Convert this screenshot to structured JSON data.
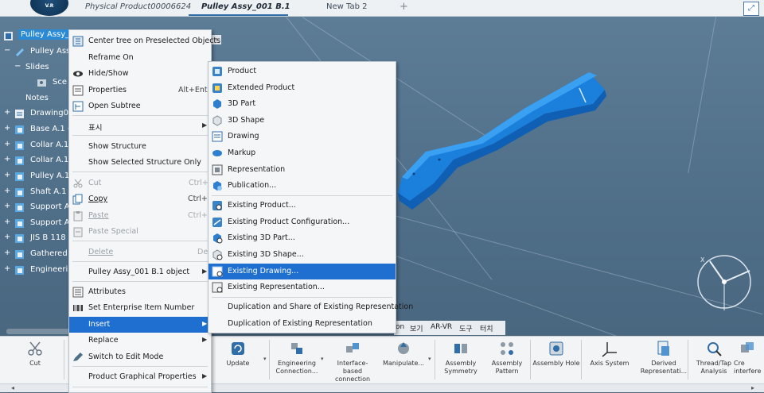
{
  "app": {
    "logo_text": "V.R",
    "tabs": [
      {
        "label": "Physical Product00006624",
        "active": false
      },
      {
        "label": "Pulley Assy_001 B.1",
        "active": true
      },
      {
        "label": "New Tab 2",
        "active": false
      }
    ],
    "new_tab_icon": "+",
    "expand_icon": "expand-icon"
  },
  "tree": {
    "items": [
      {
        "label": "Pulley Assy_0",
        "selected": true,
        "icon": "root-product-icon"
      },
      {
        "label": "Pulley Ass",
        "icon": "product-icon"
      },
      {
        "label": "Slides",
        "icon": "slides-icon"
      },
      {
        "label": "Sce",
        "icon": "scene-icon"
      },
      {
        "label": "Notes",
        "icon": "notes-icon"
      },
      {
        "label": "Drawing00",
        "icon": "drawing-icon"
      },
      {
        "label": "Base A.1 (",
        "icon": "part-icon"
      },
      {
        "label": "Collar A.1",
        "icon": "part-icon"
      },
      {
        "label": "Collar A.1",
        "icon": "part-icon"
      },
      {
        "label": "Pulley A.1",
        "icon": "part-icon"
      },
      {
        "label": "Shaft A.1 (",
        "icon": "part-icon"
      },
      {
        "label": "Support A",
        "icon": "part-icon"
      },
      {
        "label": "Support A",
        "icon": "part-icon"
      },
      {
        "label": "JIS B 118",
        "icon": "part-icon"
      },
      {
        "label": "Gathered",
        "icon": "part-icon"
      },
      {
        "label": "Engineerin",
        "icon": "part-icon"
      }
    ]
  },
  "context_menu": {
    "items": [
      {
        "label": "Center tree on Preselected Objects",
        "icon": "center-tree-icon"
      },
      {
        "label": "Reframe On"
      },
      {
        "label": "Hide/Show",
        "icon": "eye-icon"
      },
      {
        "label": "Properties",
        "shortcut": "Alt+Enter",
        "icon": "properties-icon"
      },
      {
        "label": "Open Subtree",
        "icon": "subtree-icon"
      },
      {
        "label": "표시",
        "submenu": true
      },
      {
        "label": "Show Structure"
      },
      {
        "label": "Show Selected Structure Only"
      },
      {
        "label": "Cut",
        "shortcut": "Ctrl+X",
        "disabled": true,
        "icon": "scissors-icon"
      },
      {
        "label": "Copy",
        "shortcut": "Ctrl+C",
        "icon": "copy-icon"
      },
      {
        "label": "Paste",
        "shortcut": "Ctrl+V",
        "disabled": true,
        "icon": "paste-icon"
      },
      {
        "label": "Paste Special",
        "disabled": true,
        "icon": "paste-special-icon"
      },
      {
        "label": "Delete",
        "shortcut": "Del",
        "disabled": true
      },
      {
        "label": "Pulley Assy_001 B.1 object",
        "submenu": true
      },
      {
        "label": "Attributes",
        "icon": "attributes-icon"
      },
      {
        "label": "Set Enterprise Item Number",
        "icon": "barcode-icon"
      },
      {
        "label": "Insert",
        "submenu": true,
        "highlighted": true
      },
      {
        "label": "Replace",
        "submenu": true
      },
      {
        "label": "Switch to Edit Mode",
        "icon": "edit-mode-icon"
      },
      {
        "label": "Product Graphical Properties",
        "submenu": true
      }
    ]
  },
  "insert_submenu": {
    "items": [
      {
        "label": "Product",
        "icon": "product-icon"
      },
      {
        "label": "Extended Product",
        "icon": "extended-product-icon"
      },
      {
        "label": "3D Part",
        "icon": "3d-part-icon"
      },
      {
        "label": "3D Shape",
        "icon": "3d-shape-icon"
      },
      {
        "label": "Drawing",
        "icon": "drawing-icon"
      },
      {
        "label": "Markup",
        "icon": "markup-icon"
      },
      {
        "label": "Representation",
        "icon": "representation-icon"
      },
      {
        "label": "Publication...",
        "icon": "publication-icon"
      },
      {
        "label": "Existing Product...",
        "icon": "existing-product-icon"
      },
      {
        "label": "Existing Product Configuration...",
        "icon": "existing-config-icon"
      },
      {
        "label": "Existing 3D Part...",
        "icon": "existing-3d-part-icon"
      },
      {
        "label": "Existing 3D Shape...",
        "icon": "existing-3d-shape-icon"
      },
      {
        "label": "Existing Drawing...",
        "icon": "existing-drawing-icon",
        "highlighted": true
      },
      {
        "label": "Existing Representation...",
        "icon": "existing-representation-icon"
      },
      {
        "label": "Duplication and Share of Existing Representation"
      },
      {
        "label": "Duplication of Existing Representation"
      }
    ]
  },
  "ribbon_tabs": [
    "on",
    "보기",
    "AR-VR",
    "도구",
    "터치"
  ],
  "ribbon": {
    "buttons": [
      {
        "label": "Cut",
        "icon": "scissors-icon"
      },
      {
        "label": "Update",
        "icon": "update-icon"
      },
      {
        "label": "Engineering Connection...",
        "icon": "engineering-connection-icon"
      },
      {
        "label": "Interface-based connection",
        "icon": "interface-connection-icon"
      },
      {
        "label": "Manipulate...",
        "icon": "manipulate-icon"
      },
      {
        "label": "Assembly Symmetry",
        "icon": "assembly-symmetry-icon"
      },
      {
        "label": "Assembly Pattern",
        "icon": "assembly-pattern-icon"
      },
      {
        "label": "Assembly Hole",
        "icon": "assembly-hole-icon"
      },
      {
        "label": "Axis System",
        "icon": "axis-system-icon"
      },
      {
        "label": "Derived Representati...",
        "icon": "derived-representation-icon"
      },
      {
        "label": "Thread/Tap Analysis",
        "icon": "thread-tap-icon"
      },
      {
        "label": "Cre interfere",
        "icon": "create-interference-icon"
      }
    ]
  },
  "compass": {
    "x_label": "X"
  },
  "status": {
    "left_arrow": "◂",
    "right_arrow": "▸"
  },
  "colors": {
    "viewport_bg": "#4f6e88",
    "selection_blue": "#1f6fd0",
    "part_blue": "#1e88e8"
  }
}
